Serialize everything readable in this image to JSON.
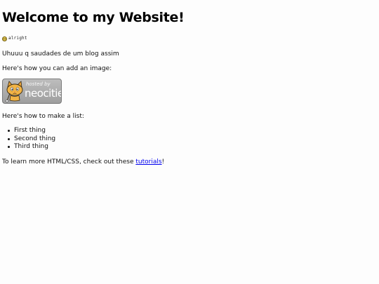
{
  "page": {
    "heading": "Welcome to my Website!",
    "status_label": "alright",
    "status_icon": "smiley-icon",
    "intro": "Uhuuu q saudades de um blog assim",
    "image_intro": "Here's how you can add an image:",
    "badge": {
      "small_text": "hosted by",
      "big_text": "neocities",
      "icon": "neocities-cat-icon"
    },
    "list_intro": "Here's how to make a list:",
    "list_items": [
      "First thing",
      "Second thing",
      "Third thing"
    ],
    "learn_prefix": "To learn more HTML/CSS, check out these ",
    "learn_link": "tutorials",
    "learn_suffix": "!",
    "colors": {
      "link": "#0000ee",
      "badge_background": "#adadad"
    }
  }
}
